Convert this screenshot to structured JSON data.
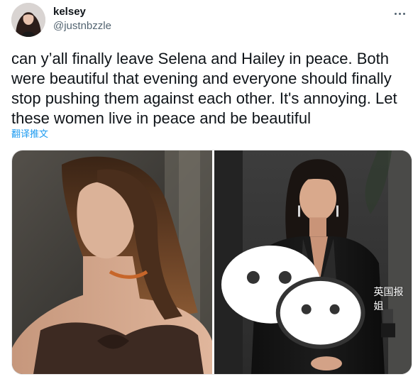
{
  "author": {
    "display_name": "kelsey",
    "handle": "@justnbzzle"
  },
  "tweet": {
    "text": "can y’all finally leave Selena and Hailey in peace. Both were beautiful that evening and everyone should finally stop pushing them against each other. It's annoying. Let these women live in peace and be beautiful",
    "translate_label": "翻译推文"
  },
  "media": {
    "photo_count": 2,
    "watermark": "英国报姐"
  },
  "colors": {
    "text_primary": "#0f1419",
    "text_secondary": "#536471",
    "link_blue": "#1d9bf0"
  }
}
